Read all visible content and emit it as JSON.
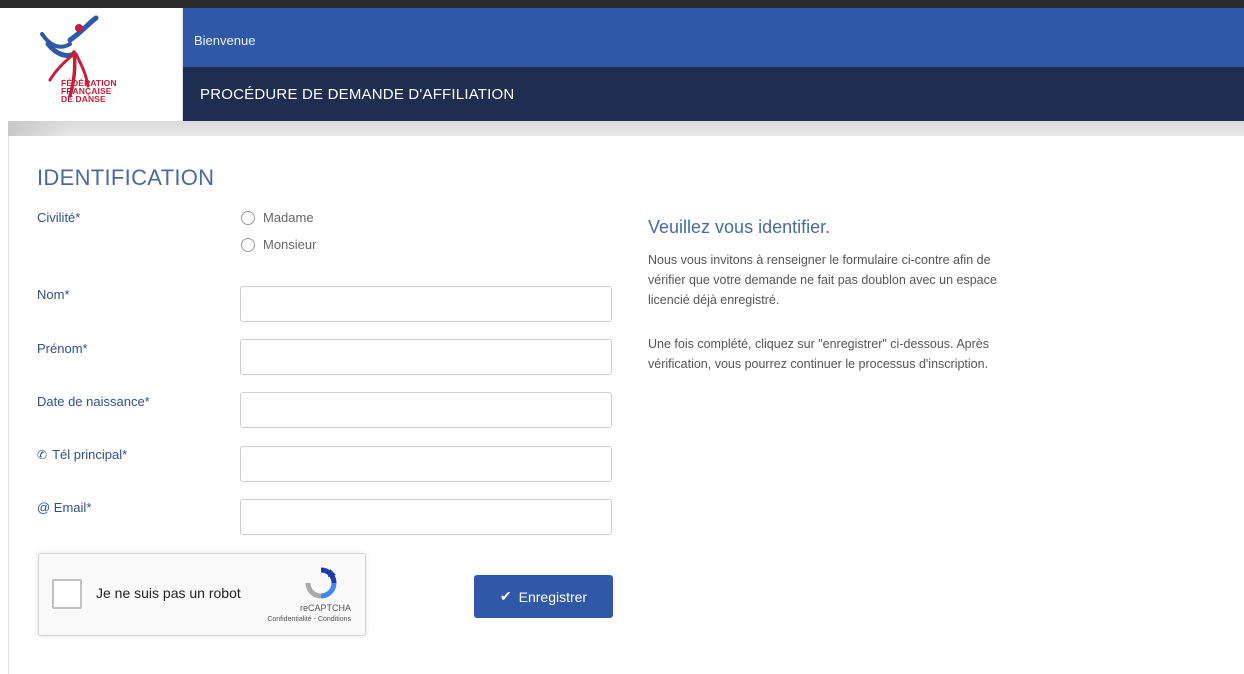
{
  "brand": {
    "logo_lines": [
      "FÉDÉRATION",
      "FRANÇAISE",
      "DE DANSE"
    ],
    "logo_colors": {
      "red": "#c41e3a",
      "blue": "#2f58a7"
    }
  },
  "header": {
    "welcome": "Bienvenue",
    "title": "PROCÉDURE DE DEMANDE D'AFFILIATION",
    "colors": {
      "top_bar": "#2f58a7",
      "title_bar": "#1d2e50"
    }
  },
  "form": {
    "section_title": "IDENTIFICATION",
    "civility": {
      "label": "Civilité*",
      "options": [
        "Madame",
        "Monsieur"
      ]
    },
    "fields": [
      {
        "label": "Nom*",
        "value": "",
        "icon": ""
      },
      {
        "label": "Prénom*",
        "value": "",
        "icon": ""
      },
      {
        "label": "Date de naissance*",
        "value": "",
        "icon": ""
      },
      {
        "label": "Tél principal*",
        "value": "",
        "icon": "phone-icon"
      },
      {
        "label": "@ Email*",
        "value": "",
        "icon": ""
      }
    ],
    "recaptcha": {
      "label": "Je ne suis pas un robot",
      "brand": "reCAPTCHA",
      "terms": "Confidentialité - Conditions"
    },
    "submit_label": "Enregistrer"
  },
  "info": {
    "title": "Veuillez vous identifier.",
    "paragraphs": [
      "Nous vous invitons à renseigner le formulaire ci-contre afin de vérifier que votre demande ne fait pas doublon avec un espace licencié déjà enregistré.",
      "Une fois complété, cliquez sur \"enregistrer\" ci-dessous. Après vérification, vous pourrez continuer le processus d'inscription."
    ]
  }
}
